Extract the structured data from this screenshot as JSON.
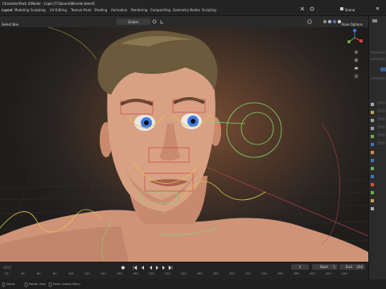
{
  "window": {
    "title": "Character\\Pack 2\\Model - Copie [T:\\Source\\Blender.blend]"
  },
  "workspaces": [
    {
      "label": "Layout",
      "active": true
    },
    {
      "label": "Modeling",
      "active": false
    },
    {
      "label": "Sculpting",
      "active": false
    },
    {
      "label": "UV Editing",
      "active": false
    },
    {
      "label": "Texture Paint",
      "active": false
    },
    {
      "label": "Shading",
      "active": false
    },
    {
      "label": "Animation",
      "active": false
    },
    {
      "label": "Rendering",
      "active": false
    },
    {
      "label": "Compositing",
      "active": false
    },
    {
      "label": "Geometry Nodes",
      "active": false
    },
    {
      "label": "Scripting",
      "active": false
    }
  ],
  "top_right": {
    "scene_label": "Scene"
  },
  "viewport_header": {
    "select_box": "Select Box",
    "mode": "Global",
    "pose_options": "Pose Options"
  },
  "timeline": {
    "current_frame": "1",
    "start_label": "Start",
    "start_value": "1",
    "end_label": "End",
    "end_value": "250",
    "ticks": [
      "20",
      "40",
      "60",
      "80",
      "100",
      "120",
      "140",
      "160",
      "180",
      "200",
      "220",
      "240",
      "260",
      "280",
      "300",
      "320",
      "340",
      "360",
      "380",
      "400",
      "420",
      "440"
    ]
  },
  "status_bar": {
    "left": "Select",
    "middle": "Rotate View",
    "right": "Pose Context Menu"
  },
  "colors": {
    "accent_blue": "#4772b3",
    "axis_red": "#e04a4a",
    "axis_green": "#6ab04c",
    "axis_blue": "#3d7be0",
    "rig_yellow": "#d9c94a",
    "rig_green": "#7fd96a",
    "rig_red": "#c84848",
    "skin": "#d9a184"
  }
}
